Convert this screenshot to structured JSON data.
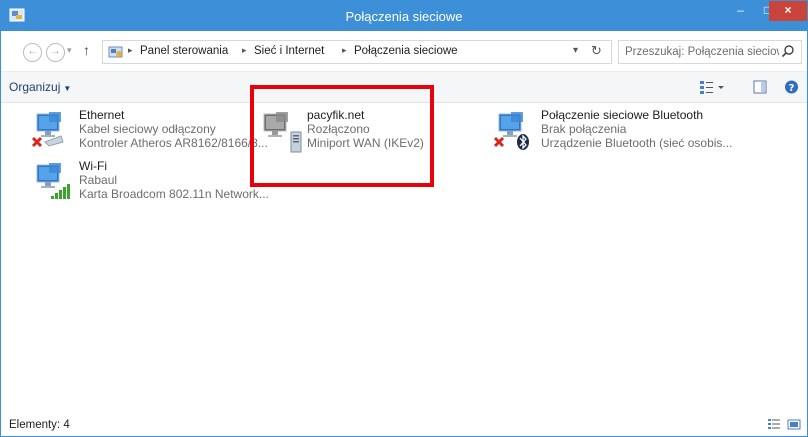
{
  "window": {
    "title": "Połączenia sieciowe",
    "accent": "#3d8fd8",
    "close_color": "#c9443a",
    "controls": {
      "minimize": "–",
      "maximize": "□",
      "close": "×"
    }
  },
  "nav": {
    "back_glyph": "←",
    "forward_glyph": "→",
    "up_glyph": "↑",
    "refresh_glyph": "↻",
    "breadcrumb": [
      "Panel sterowania",
      "Sieć i Internet",
      "Połączenia sieciowe"
    ],
    "search_placeholder": "Przeszukaj: Połączenia sieciowe"
  },
  "command_bar": {
    "organize_label": "Organizuj",
    "icons": [
      "change-view-icon",
      "preview-pane-icon",
      "help-icon"
    ]
  },
  "connections": [
    {
      "name": "Ethernet",
      "status": "Kabel sieciowy odłączony",
      "device": "Kontroler Atheros AR8162/8166/8...",
      "icon": "ethernet-disconnected-icon"
    },
    {
      "name": "pacyfik.net",
      "status": "Rozłączono",
      "device": "Miniport WAN (IKEv2)",
      "icon": "vpn-wan-icon"
    },
    {
      "name": "Połączenie sieciowe Bluetooth",
      "status": "Brak połączenia",
      "device": "Urządzenie Bluetooth (sieć osobis...",
      "icon": "bluetooth-network-icon"
    },
    {
      "name": "Wi-Fi",
      "status": "Rabaul",
      "device": "Karta Broadcom 802.11n Network...",
      "icon": "wifi-connected-icon"
    }
  ],
  "highlight_color": "#e8000b",
  "status_bar": {
    "count_text": "Elementy: 4"
  }
}
